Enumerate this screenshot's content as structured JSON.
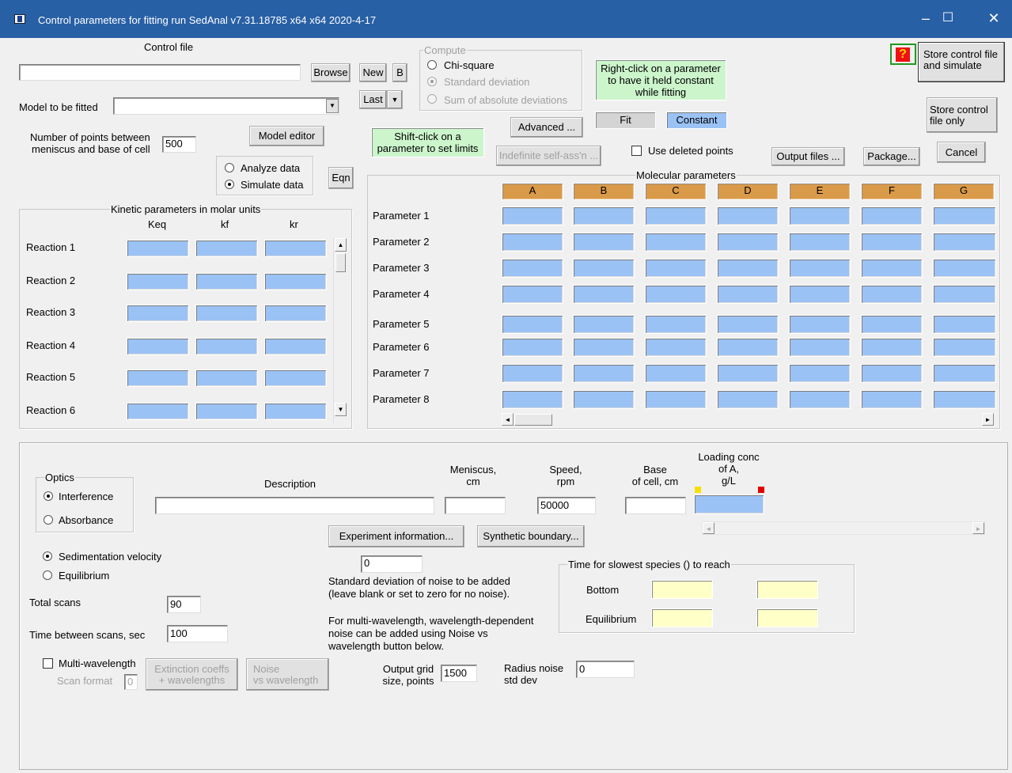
{
  "window": {
    "title": "Control parameters for fitting run   SedAnal v7.31.18785 x64 x64 2020-4-17",
    "minimize": "–",
    "maximize": "☐",
    "close": "✕"
  },
  "control_file": {
    "label": "Control file",
    "value": "",
    "browse": "Browse",
    "new": "New",
    "b": "B",
    "last": "Last"
  },
  "model": {
    "label": "Model to be fitted",
    "value": ""
  },
  "points": {
    "label1": "Number of points between",
    "label2": "meniscus and base of cell",
    "value": "500"
  },
  "model_editor": "Model editor",
  "compute": {
    "title": "Compute",
    "options": [
      "Chi-square",
      "Standard deviation",
      "Sum of absolute deviations"
    ]
  },
  "shift_note": {
    "line1": "Shift-click on a",
    "line2": "parameter to set limits"
  },
  "advanced": "Advanced ...",
  "indefinite": "Indefinite self-ass'n ...",
  "right_click_note": {
    "line1": "Right-click on a parameter",
    "line2": "to have it held constant",
    "line3": "while fitting"
  },
  "fit_label": "Fit",
  "constant_label": "Constant",
  "use_deleted": "Use deleted points",
  "output_files": "Output files ...",
  "package": "Package...",
  "cancel": "Cancel",
  "help_icon_glyph": "?",
  "store_sim": {
    "line1": "Store control file",
    "line2": "and simulate"
  },
  "store_only": {
    "line1": "Store control",
    "line2": "file only"
  },
  "mode": {
    "analyze": "Analyze data",
    "simulate": "Simulate data",
    "selected": "simulate"
  },
  "eqn": "Eqn",
  "kinetic": {
    "title": "Kinetic parameters in molar units",
    "headers": [
      "Keq",
      "kf",
      "kr"
    ],
    "reactions": [
      "Reaction 1",
      "Reaction 2",
      "Reaction 3",
      "Reaction 4",
      "Reaction 5",
      "Reaction 6"
    ]
  },
  "molecular": {
    "title": "Molecular parameters",
    "columns": [
      "A",
      "B",
      "C",
      "D",
      "E",
      "F",
      "G"
    ],
    "params": [
      "Parameter 1",
      "Parameter 2",
      "Parameter 3",
      "Parameter 4",
      "Parameter 5",
      "Parameter 6",
      "Parameter 7",
      "Parameter 8"
    ]
  },
  "optics": {
    "title": "Optics",
    "interference": "Interference",
    "absorbance": "Absorbance",
    "selected": "interference"
  },
  "description": {
    "label": "Description",
    "value": ""
  },
  "meniscus": {
    "line1": "Meniscus,",
    "line2": "cm",
    "value": ""
  },
  "speed": {
    "line1": "Speed,",
    "line2": "rpm",
    "value": "50000"
  },
  "base": {
    "line1": "Base",
    "line2": "of cell, cm",
    "value": ""
  },
  "loading": {
    "line1": "Loading conc",
    "line2": "of A,",
    "line3": "g/L"
  },
  "experiment_info": "Experiment information...",
  "synthetic_boundary": "Synthetic boundary...",
  "method": {
    "sv": "Sedimentation velocity",
    "eq": "Equilibrium",
    "selected": "sv"
  },
  "noise": {
    "value": "0",
    "line1": "Standard deviation of noise to be added",
    "line2": "(leave blank or set to zero for no noise).",
    "line3": "For multi-wavelength, wavelength-dependent",
    "line4": "noise can be added using Noise vs",
    "line5": "wavelength button below."
  },
  "time_reach": {
    "title": "Time for slowest species () to reach",
    "bottom": "Bottom",
    "equilibrium": "Equilibrium"
  },
  "total_scans": {
    "label": "Total scans",
    "value": "90"
  },
  "time_between": {
    "label": "Time between scans, sec",
    "value": "100"
  },
  "multi_wl": {
    "label": "Multi-wavelength",
    "scan_format": "Scan format",
    "scan_value": "0"
  },
  "extinction": {
    "line1": "Extinction coeffs",
    "line2": "+ wavelengths"
  },
  "noise_vs": {
    "line1": "Noise",
    "line2": "vs wavelength"
  },
  "output_grid": {
    "line1": "Output grid",
    "line2": "size, points",
    "value": "1500"
  },
  "radius_noise": {
    "line1": "Radius noise",
    "line2": "std dev",
    "value": "0"
  }
}
